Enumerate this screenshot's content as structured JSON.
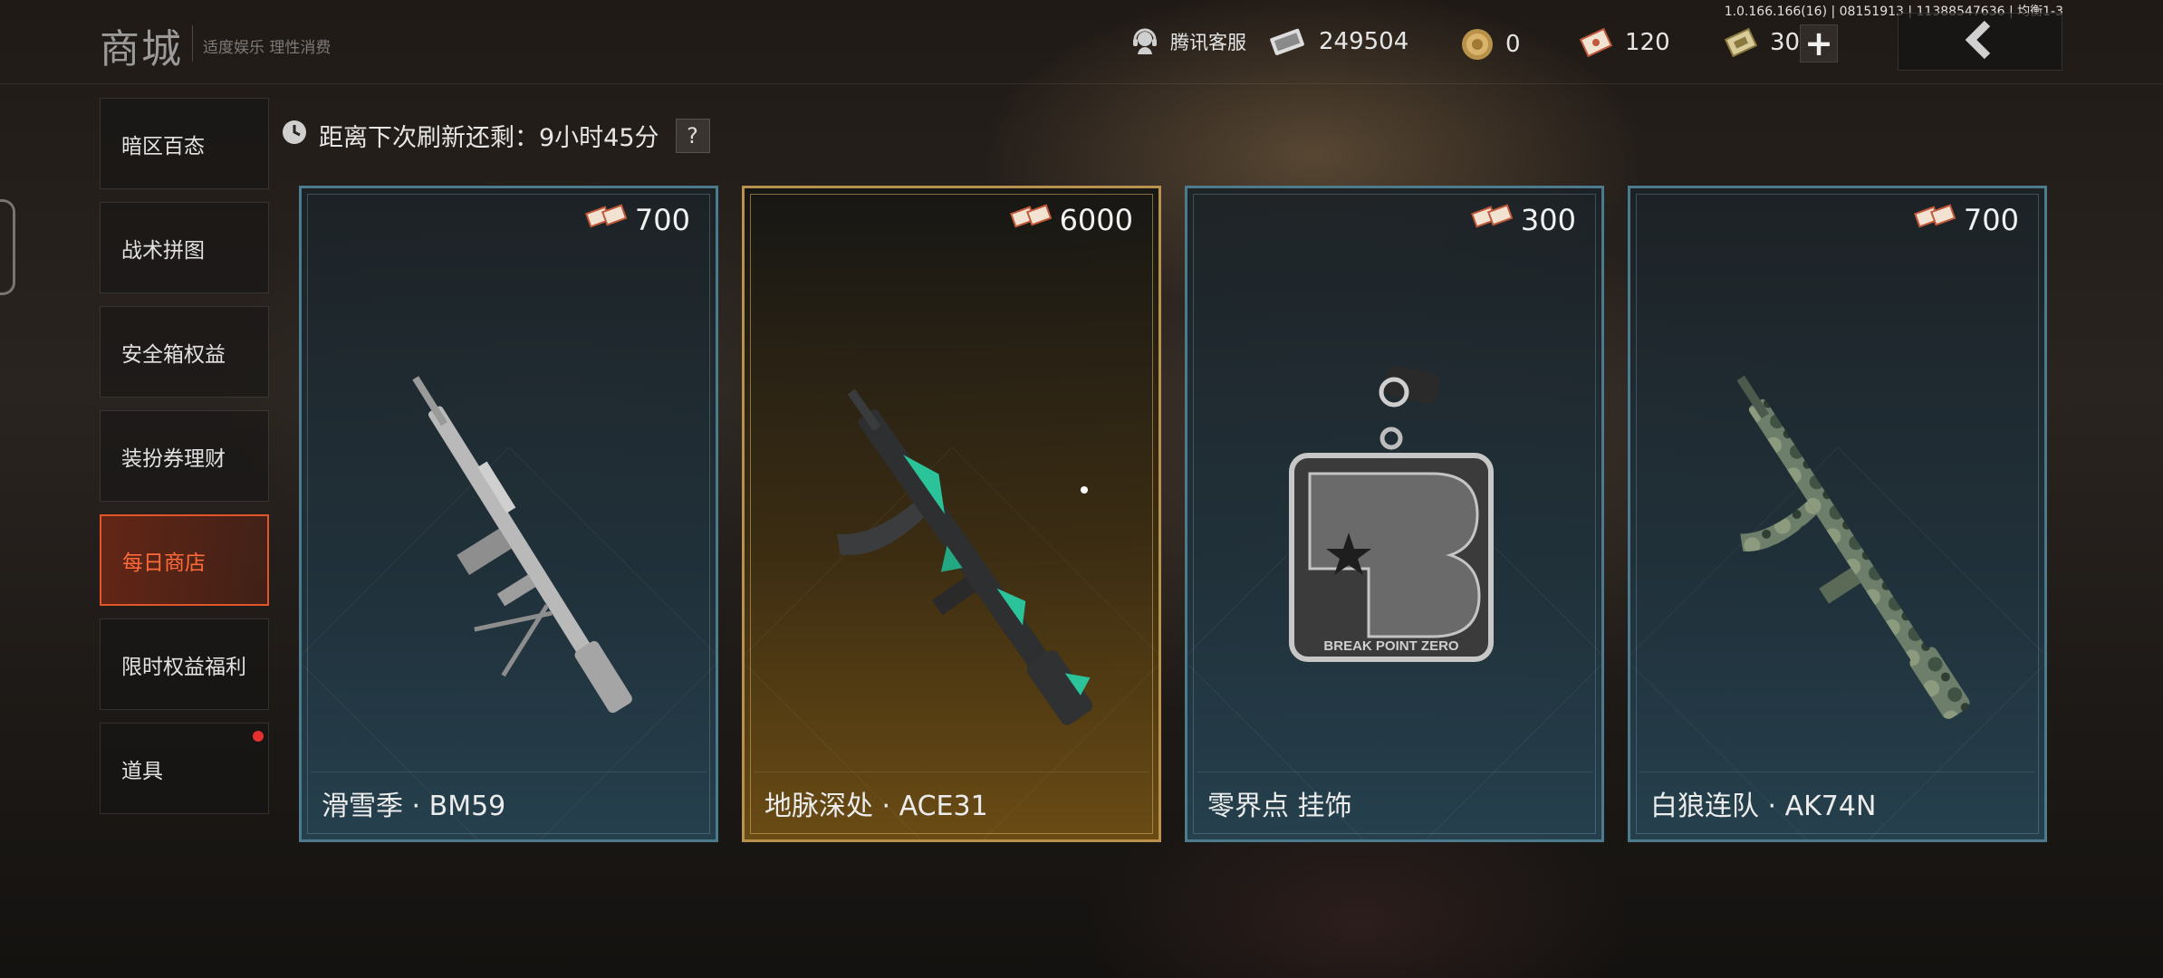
{
  "header": {
    "title": "商城",
    "subtitle": "适度娱乐 理性消费",
    "version": "1.0.166.166(16) | 08151913 | 11388547636 | 均衡1-3",
    "support_label": "腾讯客服",
    "currencies": [
      {
        "icon": "banknote-icon",
        "value": "249504"
      },
      {
        "icon": "coin-icon",
        "value": "0"
      },
      {
        "icon": "ticket-icon",
        "value": "120"
      },
      {
        "icon": "voucher-icon",
        "value": "30"
      }
    ],
    "plus_label": "+"
  },
  "sidebar": {
    "items": [
      {
        "label": "暗区百态",
        "active": false
      },
      {
        "label": "战术拼图",
        "active": false
      },
      {
        "label": "安全箱权益",
        "active": false
      },
      {
        "label": "装扮券理财",
        "active": false
      },
      {
        "label": "每日商店",
        "active": true
      },
      {
        "label": "限时权益福利",
        "active": false
      },
      {
        "label": "道具",
        "active": false,
        "badge": true
      }
    ]
  },
  "refresh": {
    "label": "距离下次刷新还剩：9小时45分",
    "help": "?"
  },
  "cards": [
    {
      "name": "滑雪季 · BM59",
      "price": "700",
      "style": "blue",
      "art": "rifle-bm59-icon"
    },
    {
      "name": "地脉深处 · ACE31",
      "price": "6000",
      "style": "gold",
      "art": "rifle-ace31-icon"
    },
    {
      "name": "零界点 挂饰",
      "price": "300",
      "style": "blue",
      "art": "charm-pendant-icon",
      "charm_text": "BREAK POINT ZERO"
    },
    {
      "name": "白狼连队 · AK74N",
      "price": "700",
      "style": "blue",
      "art": "rifle-ak74n-icon"
    }
  ],
  "colors": {
    "active": "#e0552a",
    "card_border": "#4c7b8e",
    "gold_border": "#b8914f"
  }
}
